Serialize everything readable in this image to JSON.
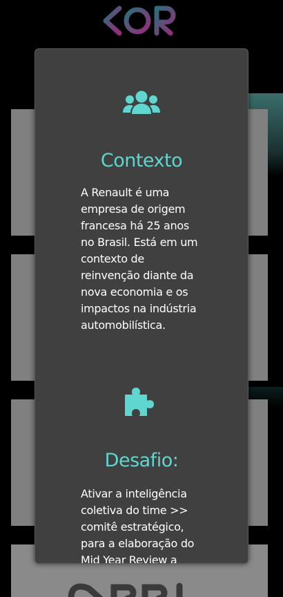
{
  "brand": {
    "logo_text": "KOR",
    "logo_color_start": "#2a6f7a",
    "logo_color_end": "#9b2a7b"
  },
  "modal": {
    "sections": [
      {
        "icon": "users-icon",
        "title": "Contexto",
        "text": "A Renault é uma empresa de origem francesa há 25 anos no Brasil. Está em um contexto de reinvenção diante da nova economia e os impactos na indústria automobilística."
      },
      {
        "icon": "puzzle-piece-icon",
        "title": "Desafio:",
        "text": "Ativar a inteligência coletiva do time >> comitê estratégico, para a elaboração do Mid Year Review a partir de"
      }
    ]
  },
  "colors": {
    "accent": "#5fd6cf",
    "modal_bg": "#404040",
    "card_bg": "#808080",
    "page_bg": "#000000"
  }
}
